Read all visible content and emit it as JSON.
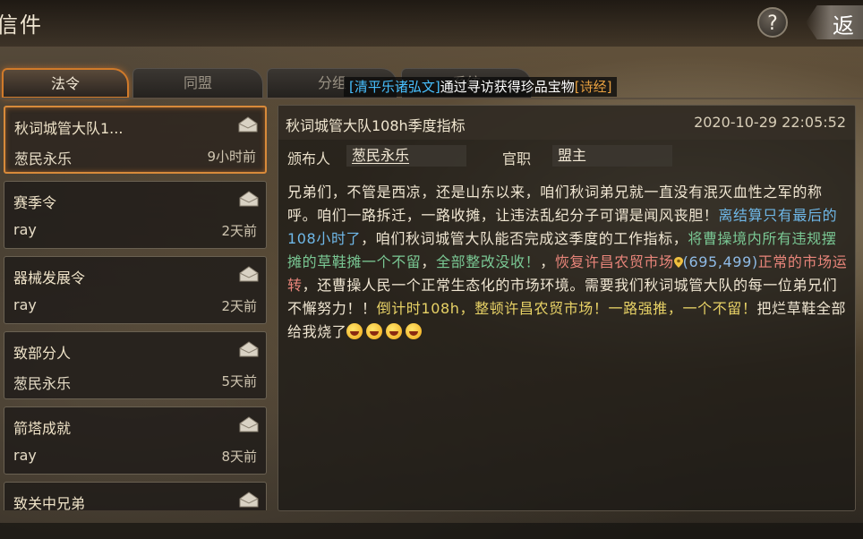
{
  "header": {
    "title": "信件",
    "help_label": "?",
    "back_label": "返"
  },
  "tabs": [
    {
      "label": "法令",
      "active": true
    },
    {
      "label": "同盟",
      "active": false
    },
    {
      "label": "分组",
      "active": false
    },
    {
      "label": "系统",
      "active": false
    }
  ],
  "marquee": {
    "tag": "[清平乐诸弘文]",
    "text": "通过寻访获得珍品宝物",
    "item": "[诗经]"
  },
  "messages": [
    {
      "title": "秋词城管大队1...",
      "sender": "葱民永乐",
      "time": "9小时前",
      "selected": true
    },
    {
      "title": "赛季令",
      "sender": "ray",
      "time": "2天前",
      "selected": false
    },
    {
      "title": "器械发展令",
      "sender": "ray",
      "time": "2天前",
      "selected": false
    },
    {
      "title": "致部分人",
      "sender": "葱民永乐",
      "time": "5天前",
      "selected": false
    },
    {
      "title": "箭塔成就",
      "sender": "ray",
      "time": "8天前",
      "selected": false
    },
    {
      "title": "致关中兄弟",
      "sender": "",
      "time": "",
      "selected": false
    }
  ],
  "detail": {
    "subject": "秋词城管大队108h季度指标",
    "date": "2020-10-29 22:05:52",
    "sender_label": "颁布人",
    "sender": "葱民永乐",
    "role_label": "官职",
    "role": "盟主",
    "body": [
      {
        "text": "兄弟们，不管是西凉，还是山东以来，咱们秋词弟兄就一直没有泯灭血性之军的称呼。咱们一路拆迁，一路收摊，让违法乱纪分子可谓是闻风丧胆！",
        "style": "plain"
      },
      {
        "text": "离结算只有最后的108小时了",
        "style": "blue"
      },
      {
        "text": "，咱们秋词城管大队能否完成这季度的工作指标，",
        "style": "plain"
      },
      {
        "text": "将曹操境内所有违规摆摊的草鞋摊一个不留",
        "style": "green"
      },
      {
        "text": "，",
        "style": "plain"
      },
      {
        "text": "全部整改没收！",
        "style": "green"
      },
      {
        "text": "，",
        "style": "plain"
      },
      {
        "text": "恢复许昌农贸市场",
        "style": "red"
      },
      {
        "text": "(695,499)",
        "style": "coord"
      },
      {
        "text": "正常的市场运转",
        "style": "red"
      },
      {
        "text": "，还曹操人民一个正常生态化的市场环境。需要我们秋词城管大队的每一位弟兄们不懈努力！！",
        "style": "plain"
      },
      {
        "text": "倒计时108h，整顿许昌农贸市场！一路强推，一个不留！",
        "style": "yellow"
      },
      {
        "text": "把烂草鞋全部给我烧了",
        "style": "plain"
      }
    ],
    "emoji_count": 4
  },
  "colors": {
    "accent": "#d88a3a",
    "link_blue": "#48c0ff",
    "item_orange": "#e8a040"
  }
}
